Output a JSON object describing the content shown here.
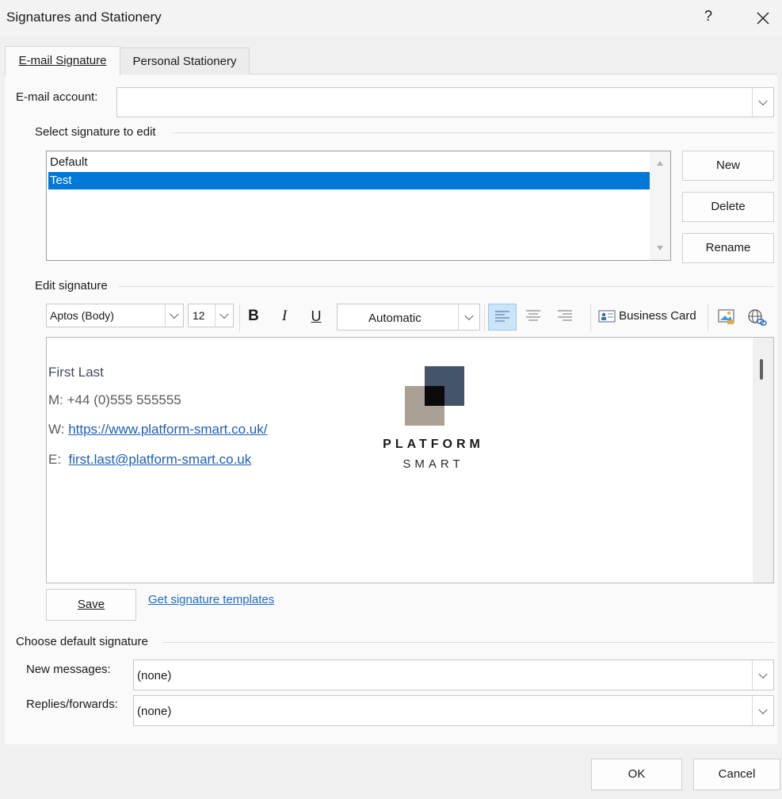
{
  "window": {
    "title": "Signatures and Stationery",
    "help_label": "?"
  },
  "tabs": [
    {
      "label": "E-mail Signature",
      "selected": true
    },
    {
      "label": "Personal Stationery",
      "selected": false
    }
  ],
  "email_account": {
    "label": "E-mail account:",
    "value": ""
  },
  "select_signature": {
    "heading": "Select signature to edit",
    "items": [
      {
        "label": "Default",
        "selected": false
      },
      {
        "label": "Test",
        "selected": true
      }
    ],
    "buttons": {
      "new": "New",
      "delete": "Delete",
      "rename": "Rename"
    }
  },
  "edit_signature": {
    "heading": "Edit signature",
    "toolbar": {
      "font": "Aptos (Body)",
      "size": "12",
      "bold": "B",
      "italic": "I",
      "underline": "U",
      "color": "Automatic",
      "business_card": "Business Card"
    },
    "content": {
      "name": "First Last",
      "mobile_prefix": "M: ",
      "mobile": "+44 (0)555 555555",
      "web_prefix": "W: ",
      "web": "https://www.platform-smart.co.uk/",
      "email_prefix": "E:  ",
      "email": "first.last@platform-smart.co.uk",
      "logo_line1": "PLATFORM",
      "logo_line2": "SMART"
    },
    "save_label": "Save",
    "templates_link": "Get signature templates"
  },
  "defaults": {
    "heading": "Choose default signature",
    "new_messages_label": "New messages:",
    "new_messages_value": "(none)",
    "replies_label": "Replies/forwards:",
    "replies_value": "(none)"
  },
  "footer": {
    "ok": "OK",
    "cancel": "Cancel"
  },
  "colors": {
    "selection": "#0078d7",
    "link": "#1f5fb8",
    "logo_dark": "#45536b",
    "logo_light": "#aaa095"
  }
}
